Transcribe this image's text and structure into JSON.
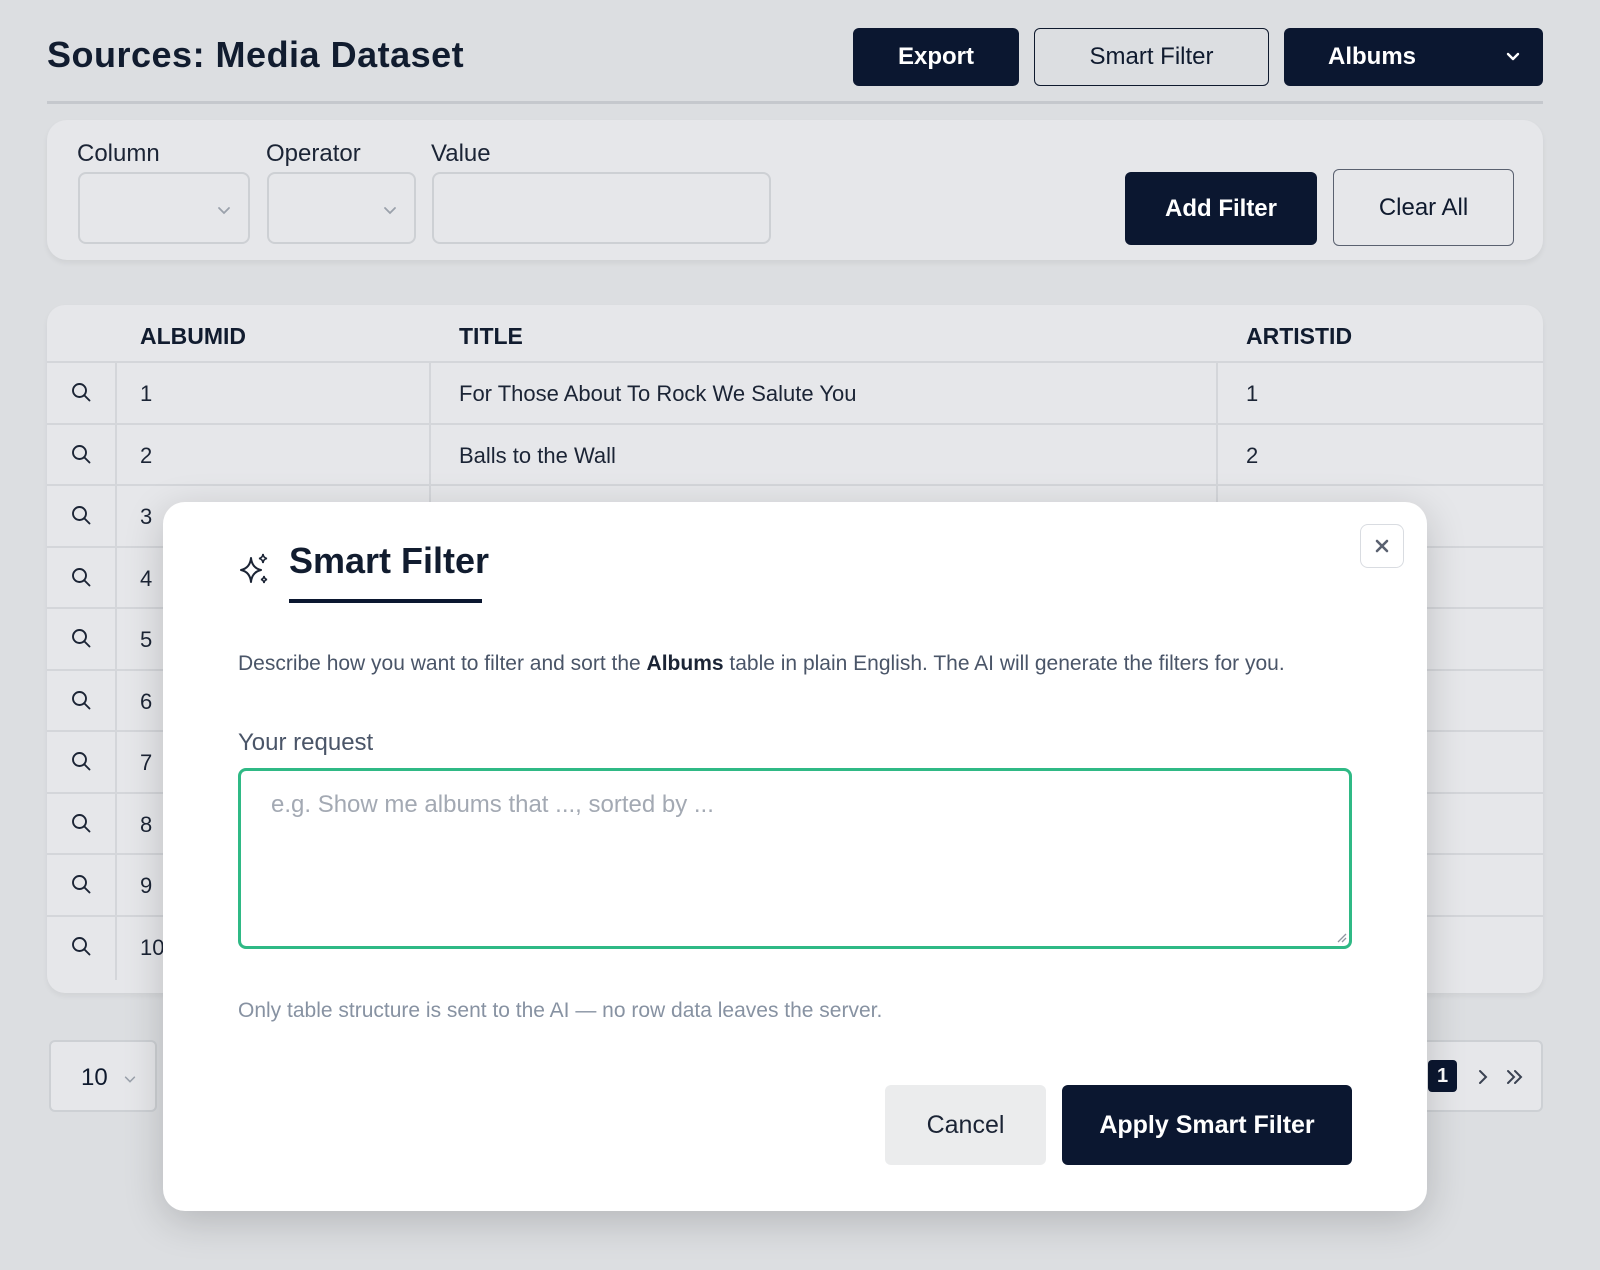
{
  "header": {
    "title": "Sources: Media Dataset",
    "export_label": "Export",
    "smart_filter_label": "Smart Filter",
    "table_select_value": "Albums"
  },
  "filters": {
    "column_label": "Column",
    "operator_label": "Operator",
    "value_label": "Value",
    "add_filter_label": "Add Filter",
    "clear_all_label": "Clear All"
  },
  "table": {
    "columns": [
      "ALBUMID",
      "TITLE",
      "ARTISTID"
    ],
    "rows": [
      {
        "albumid": "1",
        "title": "For Those About To Rock We Salute You",
        "artistid": "1"
      },
      {
        "albumid": "2",
        "title": "Balls to the Wall",
        "artistid": "2"
      },
      {
        "albumid": "3"
      },
      {
        "albumid": "4"
      },
      {
        "albumid": "5"
      },
      {
        "albumid": "6"
      },
      {
        "albumid": "7"
      },
      {
        "albumid": "8"
      },
      {
        "albumid": "9"
      },
      {
        "albumid": "10"
      }
    ]
  },
  "pagination": {
    "page_size": "10",
    "current_page": "1"
  },
  "modal": {
    "title": "Smart Filter",
    "description_pre": "Describe how you want to filter and sort the ",
    "description_bold": "Albums",
    "description_post": " table in plain English. The AI will generate the filters for you.",
    "request_label": "Your request",
    "request_placeholder": "e.g. Show me albums that ..., sorted by ...",
    "request_value": "",
    "hint": "Only table structure is sent to the AI — no row data leaves the server.",
    "cancel_label": "Cancel",
    "apply_label": "Apply Smart Filter"
  },
  "colors": {
    "primary_dark": "#0b1730",
    "focus_green": "#2fb985",
    "background": "#dcdee1"
  },
  "icons": [
    "chevron-down-icon",
    "search-icon",
    "sparkles-icon",
    "close-icon",
    "chevron-right-icon",
    "chevrons-right-icon"
  ]
}
